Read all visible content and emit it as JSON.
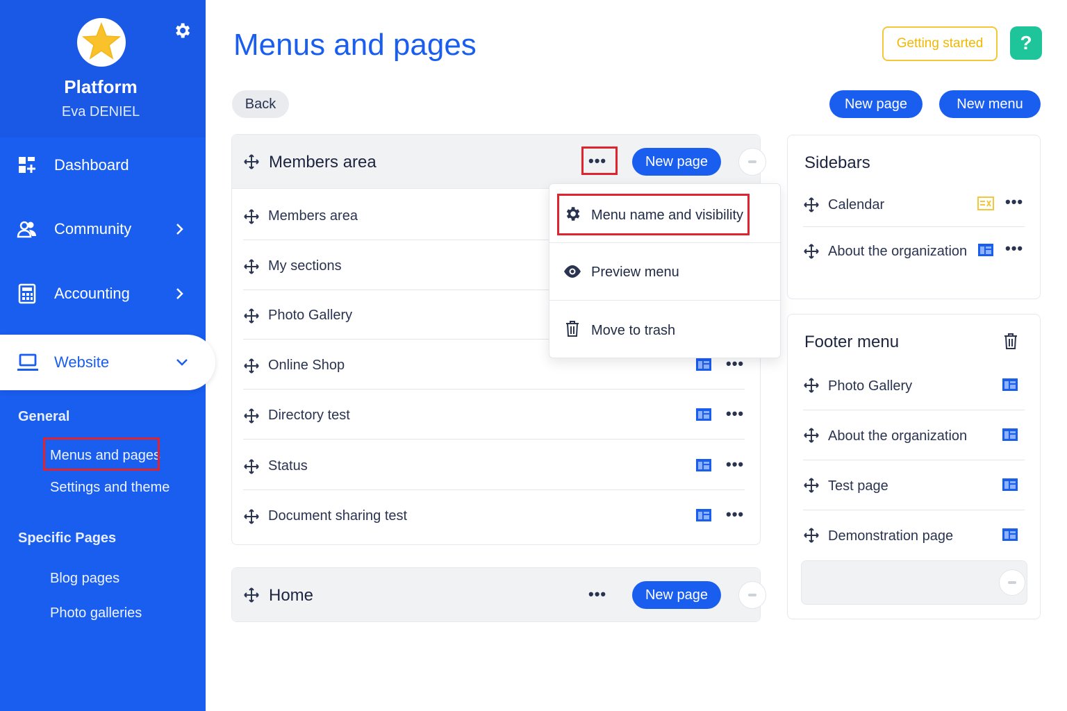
{
  "sidebar": {
    "platform": "Platform",
    "user": "Eva DENIEL",
    "nav": [
      {
        "label": "Dashboard"
      },
      {
        "label": "Community"
      },
      {
        "label": "Accounting"
      },
      {
        "label": "Website"
      }
    ],
    "general_heading": "General",
    "general_links": [
      "Menus and pages",
      "Settings and theme"
    ],
    "specific_heading": "Specific Pages",
    "specific_links": [
      "Blog pages",
      "Photo galleries"
    ]
  },
  "header": {
    "title": "Menus and pages",
    "getting_started": "Getting started",
    "help": "?"
  },
  "toolbar": {
    "back": "Back",
    "new_page": "New page",
    "new_menu": "New menu"
  },
  "members_card": {
    "title": "Members area",
    "dots": "•••",
    "new_page": "New page",
    "rows": [
      "Members area",
      "My sections",
      "Photo Gallery",
      "Online Shop",
      "Directory test",
      "Status",
      "Document sharing test"
    ],
    "row_dots": "•••"
  },
  "dropdown": {
    "items": [
      "Menu name and visibility",
      "Preview menu",
      "Move to trash"
    ]
  },
  "home_card": {
    "title": "Home",
    "dots": "•••",
    "new_page": "New page"
  },
  "sidebars_card": {
    "title": "Sidebars",
    "rows": [
      "Calendar",
      "About the organization"
    ],
    "dots": "•••"
  },
  "footer_card": {
    "title": "Footer menu",
    "rows": [
      "Photo Gallery",
      "About the organization",
      "Test page",
      "Demonstration page"
    ]
  },
  "colors": {
    "brand_blue": "#1a5ef0",
    "highlight_red": "#e0242f",
    "help_green": "#1ec59a",
    "started_yellow": "#f4c63a"
  }
}
